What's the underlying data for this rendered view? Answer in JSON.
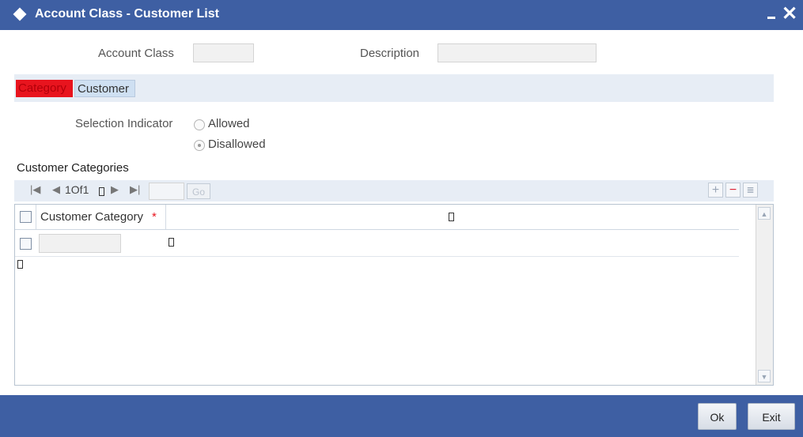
{
  "window": {
    "title": "Account Class - Customer List"
  },
  "header": {
    "account_class_label": "Account Class",
    "account_class_value": "",
    "description_label": "Description",
    "description_value": ""
  },
  "tabs": [
    {
      "label": "Category",
      "active": true
    },
    {
      "label": "Customer",
      "active": false
    }
  ],
  "selection": {
    "label": "Selection Indicator",
    "options": [
      "Allowed",
      "Disallowed"
    ],
    "selected": "Disallowed"
  },
  "categories": {
    "title": "Customer Categories",
    "pager": {
      "page_text": "1Of1",
      "go_label": "Go",
      "page_input": ""
    },
    "column_header": "Customer Category",
    "required_mark": "*",
    "rows": [
      {
        "value": ""
      }
    ]
  },
  "footer": {
    "ok_label": "Ok",
    "exit_label": "Exit"
  },
  "colors": {
    "title_bar": "#3e5fa3",
    "active_tab": "#e8141e",
    "tab_strip": "#e7edf5"
  },
  "icons": [
    "diamond-icon",
    "minimize-icon",
    "close-icon",
    "first-page-icon",
    "prev-page-icon",
    "next-page-icon",
    "last-page-icon",
    "add-row-icon",
    "delete-row-icon",
    "single-view-icon",
    "scroll-up-icon",
    "scroll-down-icon"
  ]
}
